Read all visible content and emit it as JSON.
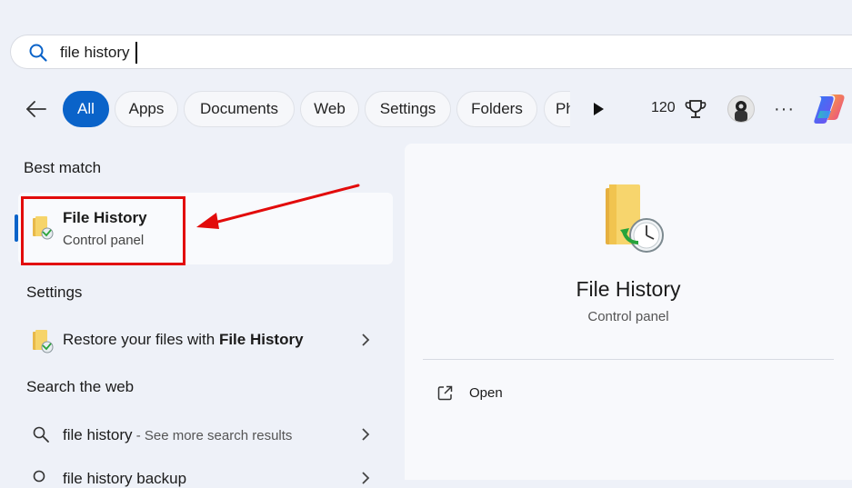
{
  "search": {
    "value": "file history",
    "icon": "search-icon"
  },
  "filters": {
    "back_icon": "back-arrow-icon",
    "chips": [
      {
        "label": "All",
        "active": true
      },
      {
        "label": "Apps"
      },
      {
        "label": "Documents"
      },
      {
        "label": "Web"
      },
      {
        "label": "Settings"
      },
      {
        "label": "Folders"
      },
      {
        "label": "Ph"
      }
    ],
    "play_icon": "play-icon",
    "points": "120",
    "trophy_icon": "trophy-icon",
    "more_label": "···",
    "copilot_icon": "copilot-icon"
  },
  "best_match": {
    "heading": "Best match",
    "title": "File History",
    "subtitle": "Control panel"
  },
  "settings": {
    "heading": "Settings",
    "item_prefix": "Restore your files with ",
    "item_bold": "File History"
  },
  "web": {
    "heading": "Search the web",
    "query": "file history",
    "suffix": " - See more search results",
    "next_query": "file history backup"
  },
  "preview": {
    "title": "File History",
    "subtitle": "Control panel",
    "open_label": "Open"
  },
  "colors": {
    "accent": "#0a63c9",
    "highlight": "#e20b0b",
    "background": "#eef1f8"
  }
}
